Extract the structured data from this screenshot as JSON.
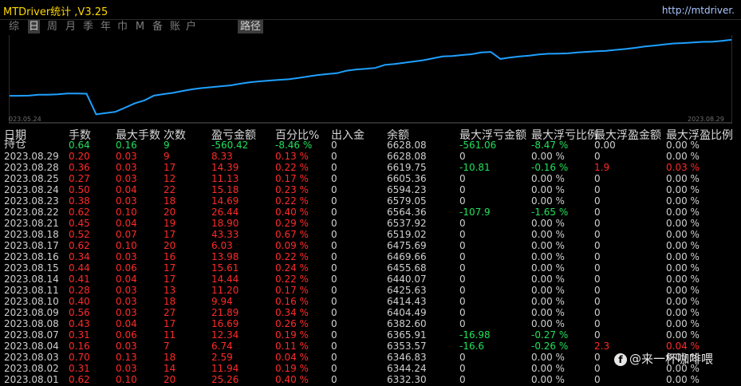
{
  "app": {
    "title": "MTDriver统计 ,V3.25",
    "url": "http://mtdriver."
  },
  "tabs": [
    {
      "label": "综",
      "active": false
    },
    {
      "label": "日",
      "active": true
    },
    {
      "label": "周",
      "active": false
    },
    {
      "label": "月",
      "active": false
    },
    {
      "label": "季",
      "active": false
    },
    {
      "label": "年",
      "active": false
    },
    {
      "label": "巾",
      "active": false
    },
    {
      "label": "M",
      "active": false
    },
    {
      "label": "备",
      "active": false
    },
    {
      "label": "账",
      "active": false
    },
    {
      "label": "户",
      "active": false
    }
  ],
  "path_tab": "路径",
  "chart": {
    "start_label": "023.05.24",
    "end_label": "2023.08.29",
    "line_color": "#1fa0ff"
  },
  "chart_data": {
    "type": "line",
    "x_start": "023.05.24",
    "x_end": "2023.08.29",
    "values": [
      55.4,
      55.4,
      55.5,
      56.2,
      56.2,
      56.6,
      57.2,
      57.2,
      57.0,
      41.0,
      42.0,
      43.0,
      46.2,
      49.5,
      51.8,
      55.5,
      56.7,
      57.7,
      59.2,
      60.5,
      61.4,
      62.1,
      62.8,
      63.5,
      64.8,
      65.9,
      66.6,
      67.2,
      67.8,
      68.2,
      69.2,
      70.4,
      71.5,
      72.2,
      72.9,
      74.8,
      75.8,
      76.3,
      77.0,
      79.4,
      80.1,
      81.0,
      82.0,
      83.0,
      84.5,
      85.9,
      86.2,
      87.0,
      87.6,
      89.0,
      89.4,
      84.0,
      85.1,
      85.9,
      86.5,
      87.5,
      88.0,
      88.1,
      88.3,
      89.0,
      89.5,
      90.0,
      90.3,
      91.0,
      91.7,
      92.6,
      93.7,
      94.4,
      95.2,
      96.0,
      96.3,
      96.8,
      97.2,
      97.3,
      98.0,
      98.8
    ]
  },
  "table": {
    "headers": [
      "日期",
      "手数",
      "最大手数",
      "次数",
      "盈亏金额",
      "百分比%",
      "出入金",
      "余额",
      "最大浮亏金额",
      "最大浮亏比例",
      "最大浮盈金额",
      "最大浮盈比例"
    ],
    "rows": [
      {
        "cells": [
          "持仓",
          "0.64",
          "0.16",
          "9",
          "-560.42",
          "-8.46 %",
          "0",
          "6628.08",
          "-561.06",
          "-8.47 %",
          "0.00",
          "0.00 %"
        ],
        "colors": [
          "white",
          "green",
          "green",
          "green",
          "green",
          "green",
          "white",
          "white",
          "green",
          "green",
          "white",
          "white"
        ]
      },
      {
        "cells": [
          "2023.08.29",
          "0.20",
          "0.03",
          "9",
          "8.33",
          "0.13 %",
          "0",
          "6628.08",
          "0",
          "0.00 %",
          "0",
          "0.00 %"
        ],
        "colors": [
          "white",
          "red",
          "red",
          "red",
          "red",
          "red",
          "white",
          "white",
          "white",
          "white",
          "white",
          "white"
        ]
      },
      {
        "cells": [
          "2023.08.28",
          "0.36",
          "0.03",
          "17",
          "14.39",
          "0.22 %",
          "0",
          "6619.75",
          "-10.81",
          "-0.16 %",
          "1.9",
          "0.03 %"
        ],
        "colors": [
          "white",
          "red",
          "red",
          "red",
          "red",
          "red",
          "white",
          "white",
          "green",
          "green",
          "red",
          "red"
        ]
      },
      {
        "cells": [
          "2023.08.25",
          "0.27",
          "0.03",
          "12",
          "11.13",
          "0.17 %",
          "0",
          "6605.36",
          "0",
          "0.00 %",
          "0",
          "0.00 %"
        ],
        "colors": [
          "white",
          "red",
          "red",
          "red",
          "red",
          "red",
          "white",
          "white",
          "white",
          "white",
          "white",
          "white"
        ]
      },
      {
        "cells": [
          "2023.08.24",
          "0.50",
          "0.04",
          "22",
          "15.18",
          "0.23 %",
          "0",
          "6594.23",
          "0",
          "0.00 %",
          "0",
          "0.00 %"
        ],
        "colors": [
          "white",
          "red",
          "red",
          "red",
          "red",
          "red",
          "white",
          "white",
          "white",
          "white",
          "white",
          "white"
        ]
      },
      {
        "cells": [
          "2023.08.23",
          "0.38",
          "0.03",
          "18",
          "14.69",
          "0.22 %",
          "0",
          "6579.05",
          "0",
          "0.00 %",
          "0",
          "0.00 %"
        ],
        "colors": [
          "white",
          "red",
          "red",
          "red",
          "red",
          "red",
          "white",
          "white",
          "white",
          "white",
          "white",
          "white"
        ]
      },
      {
        "cells": [
          "2023.08.22",
          "0.62",
          "0.10",
          "20",
          "26.44",
          "0.40 %",
          "0",
          "6564.36",
          "-107.9",
          "-1.65 %",
          "0",
          "0.00 %"
        ],
        "colors": [
          "white",
          "red",
          "red",
          "red",
          "red",
          "red",
          "white",
          "white",
          "green",
          "green",
          "white",
          "white"
        ]
      },
      {
        "cells": [
          "2023.08.21",
          "0.45",
          "0.04",
          "19",
          "18.90",
          "0.29 %",
          "0",
          "6537.92",
          "0",
          "0.00 %",
          "0",
          "0.00 %"
        ],
        "colors": [
          "white",
          "red",
          "red",
          "red",
          "red",
          "red",
          "white",
          "white",
          "white",
          "white",
          "white",
          "white"
        ]
      },
      {
        "cells": [
          "2023.08.18",
          "0.52",
          "0.07",
          "17",
          "43.33",
          "0.67 %",
          "0",
          "6519.02",
          "0",
          "0.00 %",
          "0",
          "0.00 %"
        ],
        "colors": [
          "white",
          "red",
          "red",
          "red",
          "red",
          "red",
          "white",
          "white",
          "white",
          "white",
          "white",
          "white"
        ]
      },
      {
        "cells": [
          "2023.08.17",
          "0.62",
          "0.10",
          "20",
          "6.03",
          "0.09 %",
          "0",
          "6475.69",
          "0",
          "0.00 %",
          "0",
          "0.00 %"
        ],
        "colors": [
          "white",
          "red",
          "red",
          "red",
          "red",
          "red",
          "white",
          "white",
          "white",
          "white",
          "white",
          "white"
        ]
      },
      {
        "cells": [
          "2023.08.16",
          "0.34",
          "0.03",
          "16",
          "13.98",
          "0.22 %",
          "0",
          "6469.66",
          "0",
          "0.00 %",
          "0",
          "0.00 %"
        ],
        "colors": [
          "white",
          "red",
          "red",
          "red",
          "red",
          "red",
          "white",
          "white",
          "white",
          "white",
          "white",
          "white"
        ]
      },
      {
        "cells": [
          "2023.08.15",
          "0.44",
          "0.06",
          "17",
          "15.61",
          "0.24 %",
          "0",
          "6455.68",
          "0",
          "0.00 %",
          "0",
          "0.00 %"
        ],
        "colors": [
          "white",
          "red",
          "red",
          "red",
          "red",
          "red",
          "white",
          "white",
          "white",
          "white",
          "white",
          "white"
        ]
      },
      {
        "cells": [
          "2023.08.14",
          "0.41",
          "0.04",
          "17",
          "14.44",
          "0.22 %",
          "0",
          "6440.07",
          "0",
          "0.00 %",
          "0",
          "0.00 %"
        ],
        "colors": [
          "white",
          "red",
          "red",
          "red",
          "red",
          "red",
          "white",
          "white",
          "white",
          "white",
          "white",
          "white"
        ]
      },
      {
        "cells": [
          "2023.08.11",
          "0.28",
          "0.03",
          "13",
          "11.20",
          "0.17 %",
          "0",
          "6425.63",
          "0",
          "0.00 %",
          "0",
          "0.00 %"
        ],
        "colors": [
          "white",
          "red",
          "red",
          "red",
          "red",
          "red",
          "white",
          "white",
          "white",
          "white",
          "white",
          "white"
        ]
      },
      {
        "cells": [
          "2023.08.10",
          "0.40",
          "0.03",
          "18",
          "9.94",
          "0.16 %",
          "0",
          "6414.43",
          "0",
          "0.00 %",
          "0",
          "0.00 %"
        ],
        "colors": [
          "white",
          "red",
          "red",
          "red",
          "red",
          "red",
          "white",
          "white",
          "white",
          "white",
          "white",
          "white"
        ]
      },
      {
        "cells": [
          "2023.08.09",
          "0.56",
          "0.03",
          "27",
          "21.89",
          "0.34 %",
          "0",
          "6404.49",
          "0",
          "0.00 %",
          "0",
          "0.00 %"
        ],
        "colors": [
          "white",
          "red",
          "red",
          "red",
          "red",
          "red",
          "white",
          "white",
          "white",
          "white",
          "white",
          "white"
        ]
      },
      {
        "cells": [
          "2023.08.08",
          "0.43",
          "0.04",
          "17",
          "16.69",
          "0.26 %",
          "0",
          "6382.60",
          "0",
          "0.00 %",
          "0",
          "0.00 %"
        ],
        "colors": [
          "white",
          "red",
          "red",
          "red",
          "red",
          "red",
          "white",
          "white",
          "white",
          "white",
          "white",
          "white"
        ]
      },
      {
        "cells": [
          "2023.08.07",
          "0.31",
          "0.06",
          "11",
          "12.34",
          "0.19 %",
          "0",
          "6365.91",
          "-16.98",
          "-0.27 %",
          "0",
          "0.00 %"
        ],
        "colors": [
          "white",
          "red",
          "red",
          "red",
          "red",
          "red",
          "white",
          "white",
          "green",
          "green",
          "white",
          "white"
        ]
      },
      {
        "cells": [
          "2023.08.04",
          "0.16",
          "0.03",
          "7",
          "6.74",
          "0.11 %",
          "0",
          "6353.57",
          "-16.6",
          "-0.26 %",
          "2.3",
          "0.04 %"
        ],
        "colors": [
          "white",
          "red",
          "red",
          "red",
          "red",
          "red",
          "white",
          "white",
          "green",
          "green",
          "red",
          "red"
        ]
      },
      {
        "cells": [
          "2023.08.03",
          "0.70",
          "0.13",
          "18",
          "2.59",
          "0.04 %",
          "0",
          "6346.83",
          "0",
          "0.00 %",
          "0",
          "0.00 %"
        ],
        "colors": [
          "white",
          "red",
          "red",
          "red",
          "red",
          "red",
          "white",
          "white",
          "white",
          "white",
          "white",
          "white"
        ]
      },
      {
        "cells": [
          "2023.08.02",
          "0.31",
          "0.03",
          "14",
          "11.94",
          "0.19 %",
          "0",
          "6344.24",
          "0",
          "0.00 %",
          "0",
          "0.00 %"
        ],
        "colors": [
          "white",
          "red",
          "red",
          "red",
          "red",
          "red",
          "white",
          "white",
          "white",
          "white",
          "white",
          "white"
        ]
      },
      {
        "cells": [
          "2023.08.01",
          "0.62",
          "0.10",
          "20",
          "25.26",
          "0.40 %",
          "0",
          "6332.30",
          "0",
          "0.00 %",
          "0",
          "0.00 %"
        ],
        "colors": [
          "white",
          "red",
          "red",
          "red",
          "red",
          "red",
          "white",
          "white",
          "white",
          "white",
          "white",
          "white"
        ]
      }
    ]
  },
  "watermark": {
    "icon": "f",
    "text": "@来一杯咖啡喂"
  }
}
